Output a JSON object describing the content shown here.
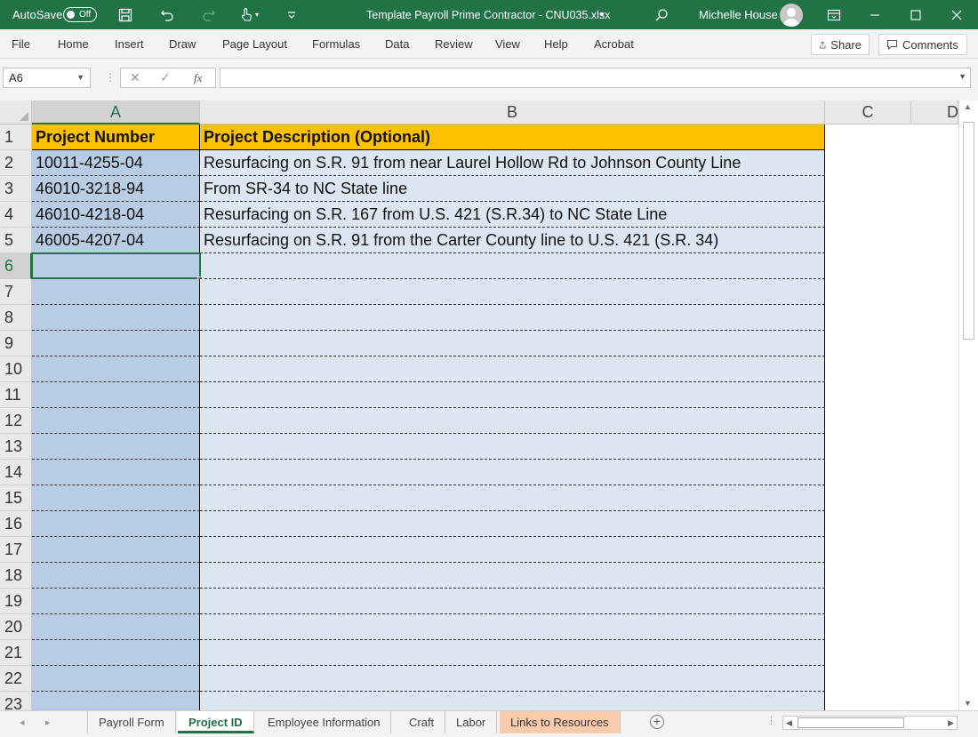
{
  "titlebar": {
    "autosave_label": "AutoSave",
    "autosave_state": "Off",
    "doc_title": "Template Payroll Prime Contractor - CNU035.xlsx",
    "user_name": "Michelle House"
  },
  "ribbon": {
    "tabs": [
      "File",
      "Home",
      "Insert",
      "Draw",
      "Page Layout",
      "Formulas",
      "Data",
      "Review",
      "View",
      "Help",
      "Acrobat"
    ],
    "share_label": "Share",
    "comments_label": "Comments"
  },
  "formula_bar": {
    "name_box": "A6",
    "fx": "fx",
    "value": ""
  },
  "grid": {
    "columns": [
      "A",
      "B",
      "C",
      "D"
    ],
    "selected_column": "A",
    "selected_row": "6",
    "header_row": {
      "A": "Project Number",
      "B": "Project Description (Optional)"
    },
    "rows": [
      {
        "num": "1",
        "A": "Project Number",
        "B": "Project Description (Optional)"
      },
      {
        "num": "2",
        "A": "10011-4255-04",
        "B": "Resurfacing on S.R. 91 from near Laurel Hollow Rd to Johnson County Line"
      },
      {
        "num": "3",
        "A": "46010-3218-94",
        "B": "From SR-34 to NC State line"
      },
      {
        "num": "4",
        "A": "46010-4218-04",
        "B": "Resurfacing on S.R. 167 from U.S. 421 (S.R.34) to NC State Line"
      },
      {
        "num": "5",
        "A": "46005-4207-04",
        "B": "Resurfacing on S.R. 91 from the Carter County line to U.S. 421 (S.R. 34)"
      },
      {
        "num": "6",
        "A": "",
        "B": ""
      },
      {
        "num": "7",
        "A": "",
        "B": ""
      },
      {
        "num": "8",
        "A": "",
        "B": ""
      },
      {
        "num": "9",
        "A": "",
        "B": ""
      },
      {
        "num": "10",
        "A": "",
        "B": ""
      },
      {
        "num": "11",
        "A": "",
        "B": ""
      },
      {
        "num": "12",
        "A": "",
        "B": ""
      },
      {
        "num": "13",
        "A": "",
        "B": ""
      },
      {
        "num": "14",
        "A": "",
        "B": ""
      },
      {
        "num": "15",
        "A": "",
        "B": ""
      },
      {
        "num": "16",
        "A": "",
        "B": ""
      },
      {
        "num": "17",
        "A": "",
        "B": ""
      },
      {
        "num": "18",
        "A": "",
        "B": ""
      },
      {
        "num": "19",
        "A": "",
        "B": ""
      },
      {
        "num": "20",
        "A": "",
        "B": ""
      },
      {
        "num": "21",
        "A": "",
        "B": ""
      },
      {
        "num": "22",
        "A": "",
        "B": ""
      },
      {
        "num": "23",
        "A": "",
        "B": ""
      }
    ]
  },
  "sheet_tabs": {
    "tabs": [
      "Payroll Form",
      "Project ID",
      "Employee Information",
      "Craft",
      "Labor",
      "Links to Resources"
    ],
    "active": "Project ID"
  },
  "colors": {
    "excel_green": "#217346",
    "header_fill": "#ffc000",
    "col_a_fill": "#b8cce4",
    "col_b_fill": "#dce6f1",
    "resources_tab_fill": "#f8cbad"
  }
}
